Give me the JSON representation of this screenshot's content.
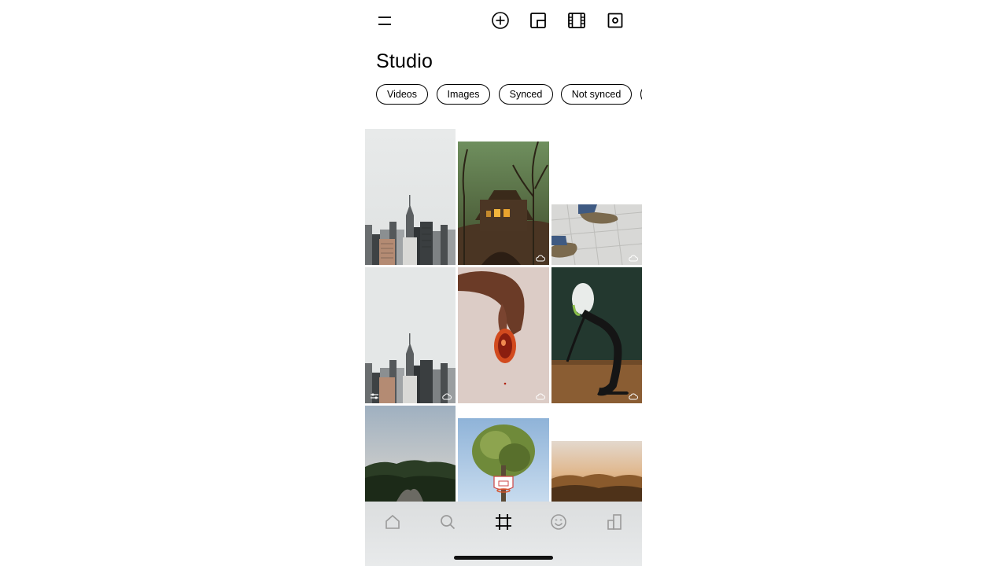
{
  "app": {
    "title": "Studio"
  },
  "toolbar": {
    "icons": [
      "menu-icon",
      "add-circle-icon",
      "picture-in-picture-icon",
      "film-icon",
      "camera-icon"
    ]
  },
  "filters": {
    "chips": [
      "Videos",
      "Images",
      "Synced",
      "Not synced"
    ]
  },
  "gallery": {
    "items": [
      {
        "subject": "city-skyline",
        "synced_icon": false
      },
      {
        "subject": "house-in-forest",
        "synced_icon": true
      },
      {
        "subject": "boots-on-pavement",
        "synced_icon": true
      },
      {
        "subject": "city-skyline",
        "synced_icon": true,
        "edited_icon": true
      },
      {
        "subject": "hand-with-fruit",
        "synced_icon": true
      },
      {
        "subject": "dancer-backbend",
        "synced_icon": true
      },
      {
        "subject": "forest-hills",
        "synced_icon": false
      },
      {
        "subject": "tree-with-hoop",
        "synced_icon": false
      },
      {
        "subject": "sunset-clouds",
        "synced_icon": false
      }
    ]
  },
  "tabbar": {
    "tabs": [
      "home-icon",
      "search-icon",
      "studio-frame-icon",
      "smiley-icon",
      "buildings-icon"
    ],
    "active_tab": "studio-frame-icon"
  },
  "colors": {
    "background": "#ffffff",
    "text": "#000000",
    "tabbar_inactive": "#9a9a9a",
    "tabbar_bg": "#e0e2e3"
  }
}
